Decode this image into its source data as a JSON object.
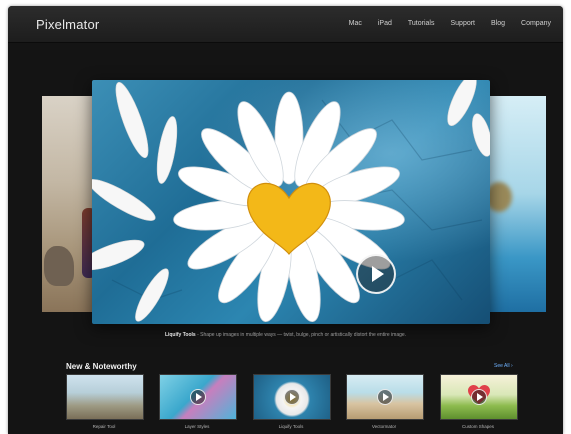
{
  "header": {
    "logo": "Pixelmator",
    "nav": [
      "Mac",
      "iPad",
      "Tutorials",
      "Support",
      "Blog",
      "Company"
    ]
  },
  "hero": {
    "caption_title": "Liquify Tools",
    "caption_text": " - Shape up images in multiple ways — twist, bulge, pinch or artistically distort the entire image."
  },
  "section": {
    "title": "New & Noteworthy",
    "see_all": "See All ›"
  },
  "thumbnails": [
    {
      "label": "Repair Tool"
    },
    {
      "label": "Layer Styles"
    },
    {
      "label": "Liquify Tools"
    },
    {
      "label": "Vectormator"
    },
    {
      "label": "Custom Shapes"
    }
  ],
  "colors": {
    "page_bg": "#141414",
    "link": "#6fb2ff",
    "flower_center": "#f3b818"
  },
  "icons": [
    "play-icon",
    "heart-icon"
  ]
}
